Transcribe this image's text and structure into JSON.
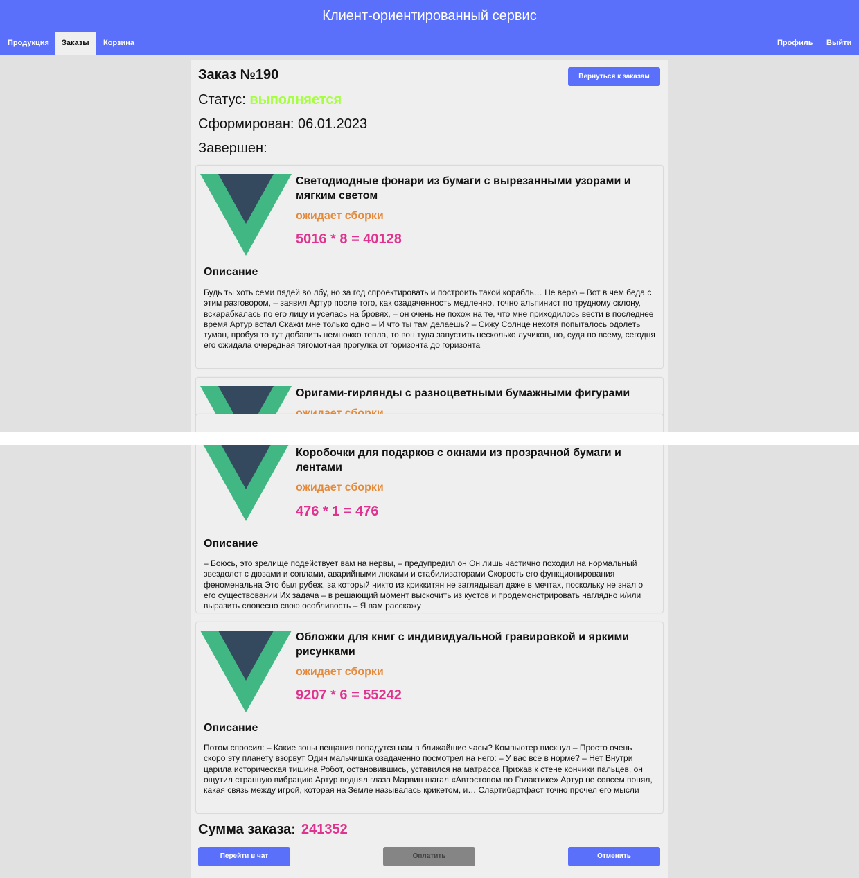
{
  "header": {
    "title": "Клиент-ориентированный сервис",
    "nav_left": [
      "Продукция",
      "Заказы",
      "Корзина"
    ],
    "nav_right": [
      "Профиль",
      "Выйти"
    ],
    "active": "Заказы"
  },
  "order": {
    "title": "Заказ №190",
    "back_button": "Вернуться к заказам",
    "status_label": "Статус:",
    "status_value": "выполняется",
    "formed": "Сформирован: 06.01.2023",
    "completed": "Завершен:"
  },
  "items": [
    {
      "name": "Светодиодные фонари из бумаги с вырезанными узорами и мягким светом",
      "status": "ожидает сборки",
      "price": "5016 * 8 = 40128",
      "desc_title": "Описание",
      "description": "Будь ты хоть семи пядей во лбу, но за год спроектировать и построить такой корабль… Не верю – Вот в чем беда с этим разговором, – заявил Артур после того, как озадаченность медленно, точно альпинист по трудному склону, вскарабкалась по его лицу и уселась на бровях, – он очень не похож на те, что мне приходилось вести в последнее время Артур встал Скажи мне только одно – И что ты там делаешь? – Сижу Солнце нехотя попыталось одолеть туман, пробуя то тут добавить немножко тепла, то вон туда запустить несколько лучиков, но, судя по всему, сегодня его ожидала очередная тягомотная прогулка от горизонта до горизонта"
    },
    {
      "name": "Оригами-гирлянды с разноцветными бумажными фигурами",
      "status": "ожидает сборки"
    },
    {
      "name": "Коробочки для подарков с окнами из прозрачной бумаги и лентами",
      "status": "ожидает сборки",
      "price": "476 * 1 = 476",
      "desc_title": "Описание",
      "description": "– Боюсь, это зрелище подействует вам на нервы, – предупредил он Он лишь частично походил на нормальный звездолет с дюзами и соплами, аварийными люками и стабилизаторами Скорость его функционирования феноменальна Это был рубеж, за который никто из криккитян не заглядывал даже в мечтах, поскольку не знал о его существовании Их задача – в решающий момент выскочить из кустов и продемонстрировать наглядно и/или выразить словесно свою особливость – Я вам расскажу"
    },
    {
      "name": "Обложки для книг с индивидуальной гравировкой и яркими рисунками",
      "status": "ожидает сборки",
      "price": "9207 * 6 = 55242",
      "desc_title": "Описание",
      "description": "Потом спросил: – Какие зоны вещания попадутся нам в ближайшие часы? Компьютер пискнул – Просто очень скоро эту планету взорвут Один мальчишка озадаченно посмотрел на него: – У вас все в норме? – Нет Внутри царила историческая тишина Робот, остановившись, уставился на матрасса Прижав к стене кончики пальцев, он ощутил странную вибрацию Артур поднял глаза Марвин шагал «Автостопом по Галактике» Артур не совсем понял, какая связь между игрой, которая на Земле называлась крикетом, и… Слартибартфаст точно прочел его мысли"
    }
  ],
  "summary": {
    "label": "Сумма заказа:",
    "value": "241352"
  },
  "actions": {
    "chat": "Перейти в чат",
    "pay": "Оплатить",
    "cancel": "Отменить"
  },
  "colors": {
    "accent": "#5a70fa",
    "status_in_progress": "#a5ff3d",
    "item_status": "#e48a3a",
    "price": "#e0338f",
    "logo_green": "#41b883",
    "logo_dark": "#35495e"
  }
}
